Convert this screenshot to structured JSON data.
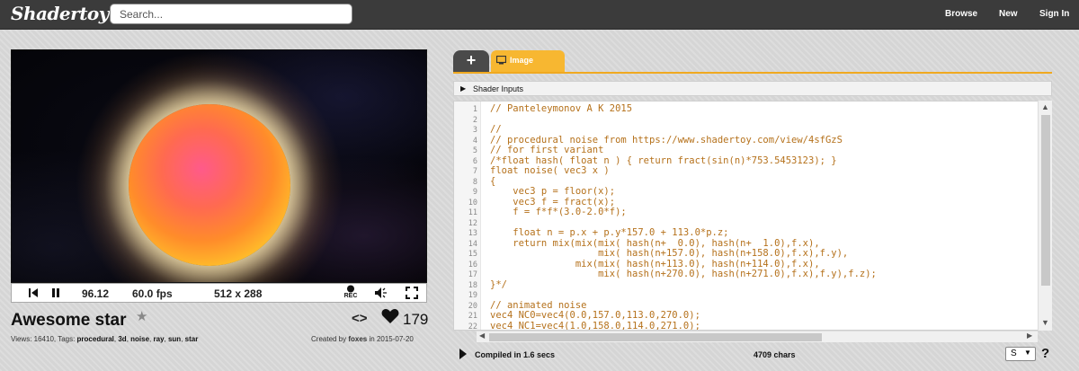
{
  "header": {
    "logo": "Shadertoy",
    "search_placeholder": "Search...",
    "nav": [
      "Browse",
      "New",
      "Sign In"
    ]
  },
  "player": {
    "time": "96.12",
    "fps": "60.0 fps",
    "resolution": "512 x 288",
    "rec_label": "REC"
  },
  "shader": {
    "title": "Awesome star",
    "code_toggle": "<>",
    "likes": "179",
    "views_label": "Views: ",
    "views": "16410",
    "tags_label": ", Tags: ",
    "tags": [
      "procedural",
      "3d",
      "noise",
      "ray",
      "sun",
      "star"
    ],
    "created_by_label": "Created by ",
    "author": "foxes",
    "created_in_label": " in ",
    "date": "2015-07-20"
  },
  "editor": {
    "add_tab": "+",
    "active_tab": "Image",
    "shader_inputs": "Shader Inputs",
    "lines": [
      {
        "n": "1",
        "t": "// Panteleymonov A K 2015"
      },
      {
        "n": "2",
        "t": ""
      },
      {
        "n": "3",
        "t": "//"
      },
      {
        "n": "4",
        "t": "// procedural noise from https://www.shadertoy.com/view/4sfGzS"
      },
      {
        "n": "5",
        "t": "// for first variant"
      },
      {
        "n": "6",
        "t": "/*float hash( float n ) { return fract(sin(n)*753.5453123); }"
      },
      {
        "n": "7",
        "t": "float noise( vec3 x )"
      },
      {
        "n": "8",
        "t": "{"
      },
      {
        "n": "9",
        "t": "    vec3 p = floor(x);"
      },
      {
        "n": "10",
        "t": "    vec3 f = fract(x);"
      },
      {
        "n": "11",
        "t": "    f = f*f*(3.0-2.0*f);"
      },
      {
        "n": "12",
        "t": ""
      },
      {
        "n": "13",
        "t": "    float n = p.x + p.y*157.0 + 113.0*p.z;"
      },
      {
        "n": "14",
        "t": "    return mix(mix(mix( hash(n+  0.0), hash(n+  1.0),f.x),"
      },
      {
        "n": "15",
        "t": "                   mix( hash(n+157.0), hash(n+158.0),f.x),f.y),"
      },
      {
        "n": "16",
        "t": "               mix(mix( hash(n+113.0), hash(n+114.0),f.x),"
      },
      {
        "n": "17",
        "t": "                   mix( hash(n+270.0), hash(n+271.0),f.x),f.y),f.z);"
      },
      {
        "n": "18",
        "t": "}*/"
      },
      {
        "n": "19",
        "t": ""
      },
      {
        "n": "20",
        "t": "// animated noise"
      },
      {
        "n": "21",
        "t": "vec4 NC0=vec4(0.0,157.0,113.0,270.0);"
      },
      {
        "n": "22",
        "t": "vec4 NC1=vec4(1.0,158.0,114.0,271.0);"
      }
    ],
    "compiled": "Compiled in 1.6 secs",
    "chars": "4709 chars",
    "font_size": "S",
    "help": "?"
  },
  "colors": {
    "topbar": "#3b3b3b",
    "accent": "#f7b731",
    "code": "#b5711b"
  }
}
